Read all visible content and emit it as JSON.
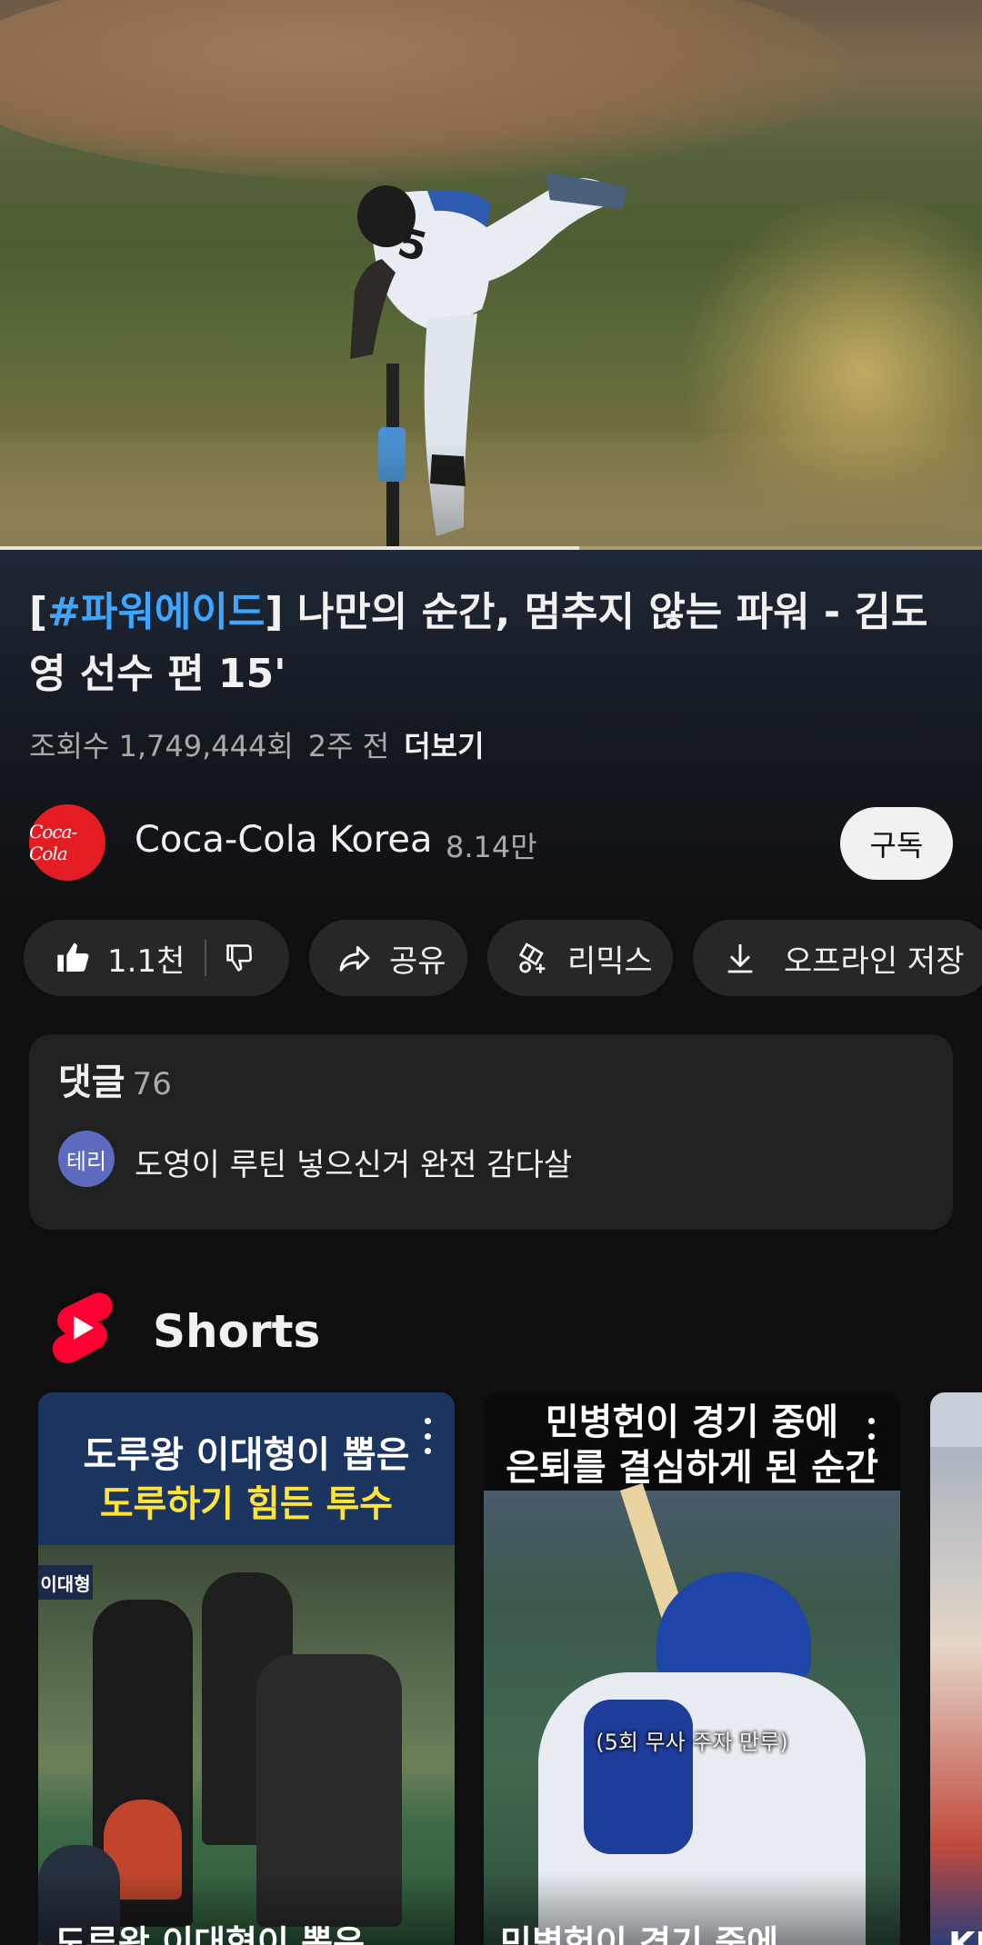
{
  "video": {
    "progress_fraction": 0.59,
    "title_hashtag": "#파워에이드",
    "title_bracket_open": "[",
    "title_rest": "] 나만의 순간, 멈추지 않는 파워 - 김도영 선수 편 15'",
    "views": "조회수 1,749,444회",
    "age": "2주 전",
    "more_label": "더보기"
  },
  "channel": {
    "avatar_text": "Coca-Cola",
    "name": "Coca-Cola Korea",
    "subscribers": "8.14만",
    "subscribe_label": "구독"
  },
  "actions": {
    "like_count": "1.1천",
    "share_label": "공유",
    "remix_label": "리믹스",
    "download_label": "오프라인 저장"
  },
  "comments": {
    "heading": "댓글",
    "count": "76",
    "top_comment_avatar": "테리",
    "top_comment_text": "도영이 루틴 넣으신거 완전 감다살"
  },
  "shorts": {
    "heading": "Shorts",
    "items": [
      {
        "line1": "도루왕 이대형이 뽑은",
        "line2": "도루하기 힘든 투수",
        "badge": "이대형",
        "bottom_title": "도루왕 이대형이 뽑은"
      },
      {
        "line1": "민병헌이 경기 중에",
        "line2": "은퇴를 결심하게 된 순간",
        "caption": "(5회 무사 주자 만루)",
        "bottom_title": "민병헌이 경기 중에"
      },
      {
        "bottom_title": "KI"
      }
    ]
  },
  "colors": {
    "background": "#0f0f0f",
    "link_blue": "#3ea6ff",
    "subscribe_bg": "#f1f1f1",
    "shorts_red": "#ff0033",
    "chip_bg": "#272727"
  }
}
